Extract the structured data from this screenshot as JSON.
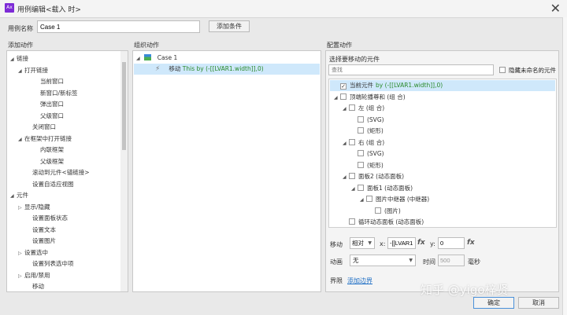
{
  "window": {
    "title": "用例编辑<载入 时>",
    "app_icon_text": "Ax"
  },
  "case_name": {
    "label": "用例名称",
    "value": "Case 1",
    "add_condition": "添加条件"
  },
  "columns": {
    "add": "添加动作",
    "organize": "组织动作",
    "config": "配置动作"
  },
  "actions_tree": [
    {
      "label": "链接",
      "level": 0,
      "expand": "open"
    },
    {
      "label": "打开链接",
      "level": 1,
      "expand": "open"
    },
    {
      "label": "当前窗口",
      "level": 3,
      "expand": ""
    },
    {
      "label": "新窗口/新标签",
      "level": 3,
      "expand": ""
    },
    {
      "label": "弹出窗口",
      "level": 3,
      "expand": ""
    },
    {
      "label": "父级窗口",
      "level": 3,
      "expand": ""
    },
    {
      "label": "关闭窗口",
      "level": 2,
      "expand": ""
    },
    {
      "label": "在框架中打开链接",
      "level": 1,
      "expand": "open"
    },
    {
      "label": "内联框架",
      "level": 3,
      "expand": ""
    },
    {
      "label": "父级框架",
      "level": 3,
      "expand": ""
    },
    {
      "label": "滚动到元件<锚链接>",
      "level": 2,
      "expand": ""
    },
    {
      "label": "设置自适应视图",
      "level": 2,
      "expand": ""
    },
    {
      "label": "元件",
      "level": 0,
      "expand": "open"
    },
    {
      "label": "显示/隐藏",
      "level": 1,
      "expand": "closed"
    },
    {
      "label": "设置面板状态",
      "level": 2,
      "expand": ""
    },
    {
      "label": "设置文本",
      "level": 2,
      "expand": ""
    },
    {
      "label": "设置图片",
      "level": 2,
      "expand": ""
    },
    {
      "label": "设置选中",
      "level": 1,
      "expand": "closed"
    },
    {
      "label": "设置列表选中项",
      "level": 2,
      "expand": ""
    },
    {
      "label": "启用/禁用",
      "level": 1,
      "expand": "closed"
    },
    {
      "label": "移动",
      "level": 2,
      "expand": ""
    }
  ],
  "organize": {
    "case": "Case 1",
    "action_prefix": "移动",
    "action_detail": "This by (-[[LVAR1.width]],0)"
  },
  "config": {
    "select_label": "选择要移动的元件",
    "search_placeholder": "查找",
    "hide_unnamed": "隐藏未命名的元件",
    "tree": [
      {
        "label": "当前元件",
        "suffix": "by (-[[LVAR1.width]],0)",
        "level": 0,
        "expand": "",
        "checked": true,
        "selected": true
      },
      {
        "label": "顶端轮播尊和 (组 合)",
        "suffix": "",
        "level": 0,
        "expand": "open",
        "checked": false,
        "selected": false
      },
      {
        "label": "左 (组 合)",
        "suffix": "",
        "level": 1,
        "expand": "open",
        "checked": false,
        "selected": false
      },
      {
        "label": "(SVG)",
        "suffix": "",
        "level": 2,
        "expand": "",
        "checked": false,
        "selected": false
      },
      {
        "label": "(矩形)",
        "suffix": "",
        "level": 2,
        "expand": "",
        "checked": false,
        "selected": false
      },
      {
        "label": "右 (组 合)",
        "suffix": "",
        "level": 1,
        "expand": "open",
        "checked": false,
        "selected": false
      },
      {
        "label": "(SVG)",
        "suffix": "",
        "level": 2,
        "expand": "",
        "checked": false,
        "selected": false
      },
      {
        "label": "(矩形)",
        "suffix": "",
        "level": 2,
        "expand": "",
        "checked": false,
        "selected": false
      },
      {
        "label": "面板2 (动态面板)",
        "suffix": "",
        "level": 1,
        "expand": "open",
        "checked": false,
        "selected": false
      },
      {
        "label": "面板1 (动态面板)",
        "suffix": "",
        "level": 2,
        "expand": "open",
        "checked": false,
        "selected": false
      },
      {
        "label": "图片中继器 (中继器)",
        "suffix": "",
        "level": 3,
        "expand": "open",
        "checked": false,
        "selected": false
      },
      {
        "label": "(图片)",
        "suffix": "",
        "level": 4,
        "expand": "",
        "checked": false,
        "selected": false
      },
      {
        "label": "循环动态面板 (动态面板)",
        "suffix": "",
        "level": 1,
        "expand": "",
        "checked": false,
        "selected": false
      }
    ],
    "move": {
      "label": "移动",
      "mode": "相对",
      "x_label": "x:",
      "x_value": "-[[LVAR1",
      "y_label": "y:",
      "y_value": "0",
      "fx": "fx"
    },
    "animate": {
      "label": "动画",
      "value": "无",
      "time_label": "时间",
      "time_value": "500",
      "unit": "毫秒"
    },
    "bounds": {
      "label": "界限",
      "link": "添加边界"
    }
  },
  "footer": {
    "ok": "确定",
    "cancel": "取消"
  },
  "watermark": "知乎 @yigo梓贤"
}
